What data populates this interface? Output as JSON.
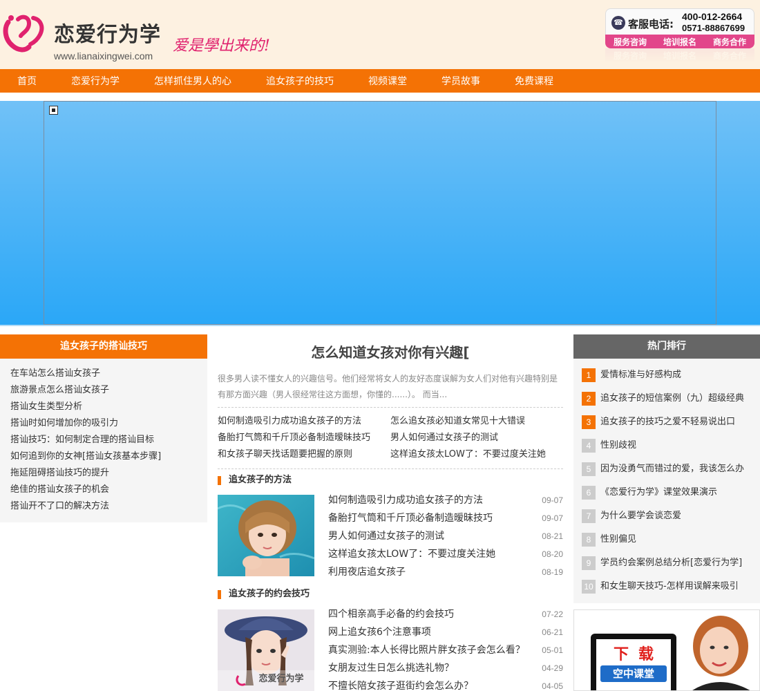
{
  "header": {
    "logo_title": "恋爱行为学",
    "logo_url": "www.lianaixingwei.com",
    "slogan": "爱是學出来的!",
    "contact_label": "客服电话:",
    "phone1": "400-012-2664",
    "phone2": "0571-88867699",
    "contact_links": [
      "服务咨询",
      "培训报名",
      "商务合作"
    ]
  },
  "nav": {
    "items": [
      "首页",
      "恋爱行为学",
      "怎样抓住男人的心",
      "追女孩子的技巧",
      "视频课堂",
      "学员故事",
      "免费课程"
    ]
  },
  "left": {
    "title": "追女孩子的搭讪技巧",
    "items": [
      "在车站怎么搭讪女孩子",
      "旅游景点怎么搭讪女孩子",
      "搭讪女生类型分析",
      "搭讪时如何增加你的吸引力",
      "搭讪技巧：如何制定合理的搭讪目标",
      "如何追到你的女神[搭讪女孩基本步骤]",
      "拖延阻碍搭讪技巧的提升",
      "绝佳的搭讪女孩子的机会",
      "搭讪开不了口的解决方法"
    ]
  },
  "center": {
    "main_title": "怎么知道女孩对你有兴趣[",
    "summary": "很多男人读不懂女人的兴趣信号。他们经常将女人的友好态度误解为女人们对他有兴趣特别是有那方面兴趣（男人很经常往这方面想，你懂的......）。 而当...",
    "links": [
      "如何制造吸引力成功追女孩子的方法",
      "怎么追女孩必知道女常见十大错误",
      "备胎打气筒和千斤顶必备制造暧昧技巧",
      "男人如何通过女孩子的测试",
      "和女孩子聊天找话题要把握的原则",
      "这样追女孩太LOW了：不要过度关注她"
    ],
    "sections": [
      {
        "title": "追女孩子的方法",
        "items": [
          {
            "title": "如何制造吸引力成功追女孩子的方法",
            "date": "09-07"
          },
          {
            "title": "备胎打气筒和千斤顶必备制造暧昧技巧",
            "date": "09-07"
          },
          {
            "title": "男人如何通过女孩子的测试",
            "date": "08-21"
          },
          {
            "title": "这样追女孩太LOW了：不要过度关注她",
            "date": "08-20"
          },
          {
            "title": "利用夜店追女孩子",
            "date": "08-19"
          }
        ]
      },
      {
        "title": "追女孩子的约会技巧",
        "photo_watermark": "恋爱行为学",
        "items": [
          {
            "title": "四个相亲高手必备的约会技巧",
            "date": "07-22"
          },
          {
            "title": "网上追女孩6个注意事项",
            "date": "06-21"
          },
          {
            "title": "真实测验:本人长得比照片胖女孩子会怎么看？",
            "date": "05-01"
          },
          {
            "title": "女朋友过生日怎么挑选礼物？",
            "date": "04-29"
          },
          {
            "title": "不擅长陪女孩子逛街约会怎么办？",
            "date": "04-05"
          }
        ]
      }
    ]
  },
  "right": {
    "title": "热门排行",
    "items": [
      {
        "num": "1",
        "text": "爱情标准与好感构成"
      },
      {
        "num": "2",
        "text": "追女孩子的短信案例（九）超级经典"
      },
      {
        "num": "3",
        "text": "追女孩子的技巧之爱不轻易说出口"
      },
      {
        "num": "4",
        "text": "性别歧视"
      },
      {
        "num": "5",
        "text": "因为没勇气而错过的爱，我该怎么办"
      },
      {
        "num": "6",
        "text": "《恋爱行为学》课堂效果演示"
      },
      {
        "num": "7",
        "text": "为什么要学会谈恋爱"
      },
      {
        "num": "8",
        "text": "性别偏见"
      },
      {
        "num": "9",
        "text": "学员约会案例总结分析[恋爱行为学]"
      },
      {
        "num": "10",
        "text": "和女生聊天技巧-怎样用误解来吸引"
      }
    ]
  },
  "ad": {
    "line1": "下载",
    "line2": "空中课堂"
  },
  "colors": {
    "accent": "#f47205",
    "brand_pink": "#e0226e",
    "banner_top": "#71c1f7",
    "banner_bottom": "#2aa7f7"
  }
}
